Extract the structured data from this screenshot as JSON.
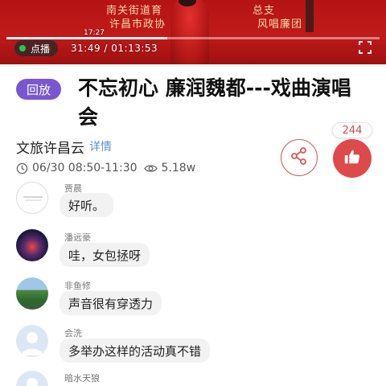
{
  "video": {
    "banner_lines": [
      "南关街道育",
      "许昌市政协",
      "总支",
      "风唱廉团"
    ],
    "clock": "17:27",
    "mode_label": "点播",
    "play_time": "31:49 / 01:13:53",
    "progress_fraction": 0.431,
    "colors": {
      "stage_red": "#c01a1a",
      "live_dot": "#29c35a"
    }
  },
  "program": {
    "badge": "回放",
    "title": "不忘初心 廉润魏都---戏曲演唱会",
    "channel": "文旅许昌云",
    "detail_link": "详情",
    "time_icon": "clock-icon",
    "time_range": "06/30 08:50-11:30",
    "views_icon": "eye-icon",
    "views": "5.18w"
  },
  "actions": {
    "like_count": "244",
    "share_icon": "share-icon",
    "like_icon": "thumbs-up-icon",
    "accent": "#dd4a4a",
    "badge_color": "#7a57d1"
  },
  "comments": [
    {
      "name": "贾晨",
      "text": "好听。",
      "avatar": "logo-avatar"
    },
    {
      "name": "潘远豪",
      "text": "哇，女包拯呀",
      "avatar": "night-avatar"
    },
    {
      "name": "非鱼修",
      "text": "声音很有穿透力",
      "avatar": "nature-avatar"
    },
    {
      "name": "会洗",
      "text": "多举办这样的活动真不错",
      "avatar": "default-avatar"
    },
    {
      "name": "暗水天狼",
      "text": "",
      "avatar": "default-avatar"
    }
  ]
}
